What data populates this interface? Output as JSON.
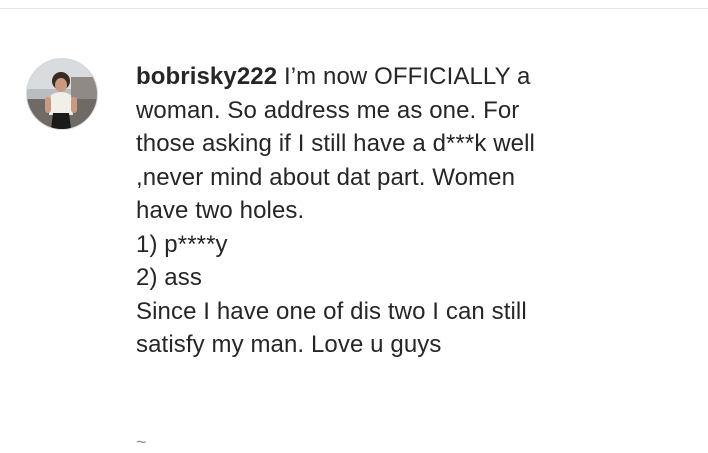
{
  "comment": {
    "username": "bobrisky222",
    "lines": [
      "I’m now OFFICIALLY a",
      "woman. So address me as one. For",
      "those asking if I still have a d***k well",
      ",never mind about dat part. Women",
      "have two holes.",
      "1) p****y",
      "2) ass",
      "Since I have one of dis two I can still",
      "satisfy my man. Love u guys"
    ]
  },
  "more_indicator": "~"
}
